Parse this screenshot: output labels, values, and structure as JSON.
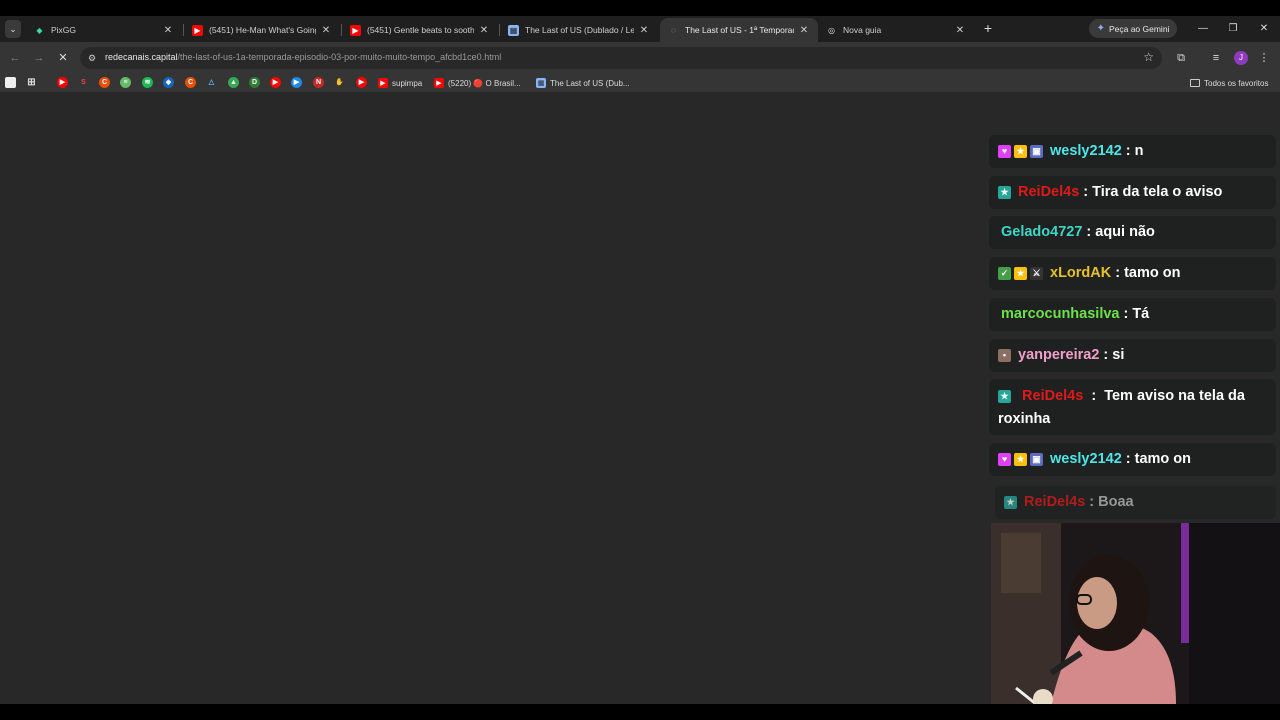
{
  "tabs": [
    {
      "title": "PixGG",
      "active": false,
      "favicon": "pixgg-icon"
    },
    {
      "title": "(5451) He-Man What's Going O",
      "active": false,
      "favicon": "youtube-icon"
    },
    {
      "title": "(5451) Gentle beats to soothe a",
      "active": false,
      "favicon": "youtube-icon"
    },
    {
      "title": "The Last of US (Dublado / Lege",
      "active": false,
      "favicon": "site-icon"
    },
    {
      "title": "The Last of US - 1ª Temporada",
      "active": true,
      "favicon": "loading-icon"
    },
    {
      "title": "Nova guia",
      "active": false,
      "favicon": "chrome-icon"
    }
  ],
  "gemini_button": "Peça ao Gemini",
  "address_bar": {
    "host": "redecanais.capital",
    "path": "/the-last-of-us-1a-temporada-episodio-03-por-muito-muito-tempo_afcbd1ce0.html"
  },
  "profile_initial": "J",
  "bookmarks": {
    "labeled": [
      {
        "label": "supimpa"
      },
      {
        "label": "(5220) 🔴 O Brasil..."
      },
      {
        "label": "The Last of US (Dub..."
      }
    ],
    "all_bookmarks_label": "Todos os favoritos"
  },
  "chat": [
    {
      "badges": [
        "#e040fb",
        "#ffc107",
        "#5c6bc0"
      ],
      "user": "wesly2142",
      "user_color": "#4ee6e6",
      "text": "n"
    },
    {
      "badges": [
        "#26a69a"
      ],
      "user": "ReiDel4s",
      "user_color": "#e01919",
      "text": "Tira da tela o aviso"
    },
    {
      "badges": [],
      "user": "Gelado4727",
      "user_color": "#3fd6c4",
      "text": "aqui não"
    },
    {
      "badges": [
        "#43a047",
        "#ffc107",
        "#333333"
      ],
      "user": "xLordAK",
      "user_color": "#e8c02a",
      "text": "tamo on"
    },
    {
      "badges": [],
      "user": "marcocunhasilva",
      "user_color": "#6ee04a",
      "text": "Tá"
    },
    {
      "badges": [
        "#8d6e63"
      ],
      "user": "yanpereira2",
      "user_color": "#f0a0c8",
      "text": "si"
    },
    {
      "badges": [
        "#26a69a"
      ],
      "user": "ReiDel4s",
      "user_color": "#e01919",
      "text": "Tem aviso na tela da roxinha"
    },
    {
      "badges": [
        "#e040fb",
        "#ffc107",
        "#5c6bc0"
      ],
      "user": "wesly2142",
      "user_color": "#4ee6e6",
      "text": "tamo on"
    },
    {
      "badges": [
        "#26a69a"
      ],
      "user": "ReiDel4s",
      "user_color": "#e01919",
      "text": "Boaa"
    }
  ]
}
